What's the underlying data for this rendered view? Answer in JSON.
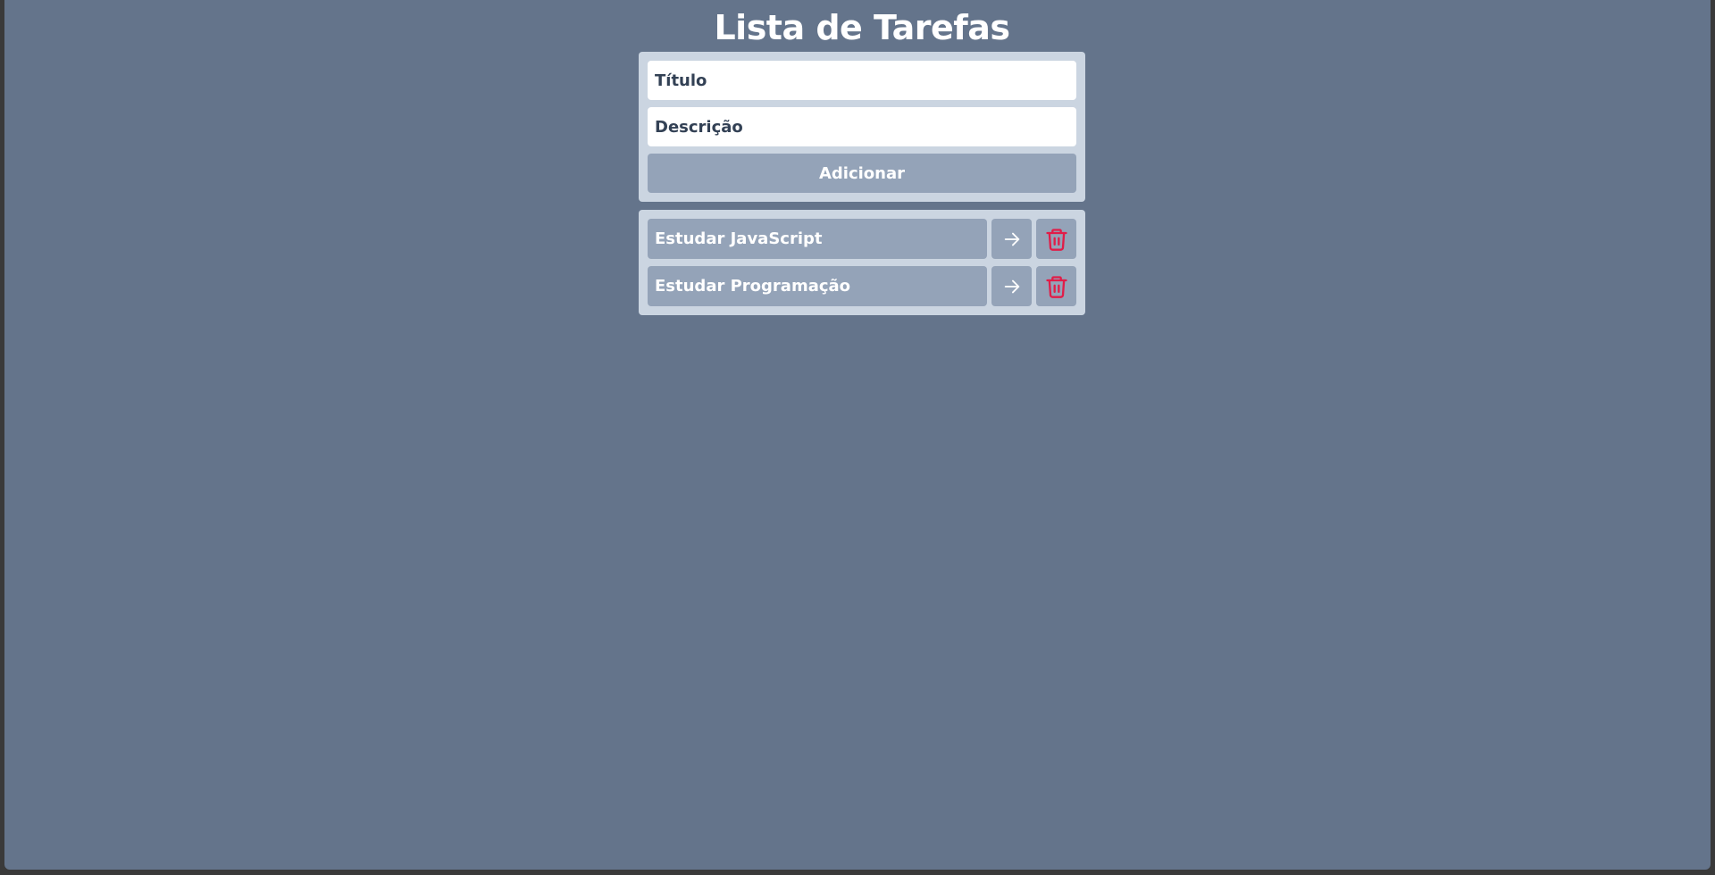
{
  "header": {
    "title": "Lista de Tarefas"
  },
  "form": {
    "title_placeholder": "Título",
    "description_placeholder": "Descrição",
    "add_label": "Adicionar"
  },
  "tasks": [
    {
      "title": "Estudar JavaScript"
    },
    {
      "title": "Estudar Programação"
    }
  ],
  "icons": {
    "details": "arrow-right-icon",
    "delete": "trash-icon"
  },
  "colors": {
    "background": "#64748b",
    "card": "#cbd5e1",
    "button": "#94a3b8",
    "delete_icon": "#e11d48"
  }
}
